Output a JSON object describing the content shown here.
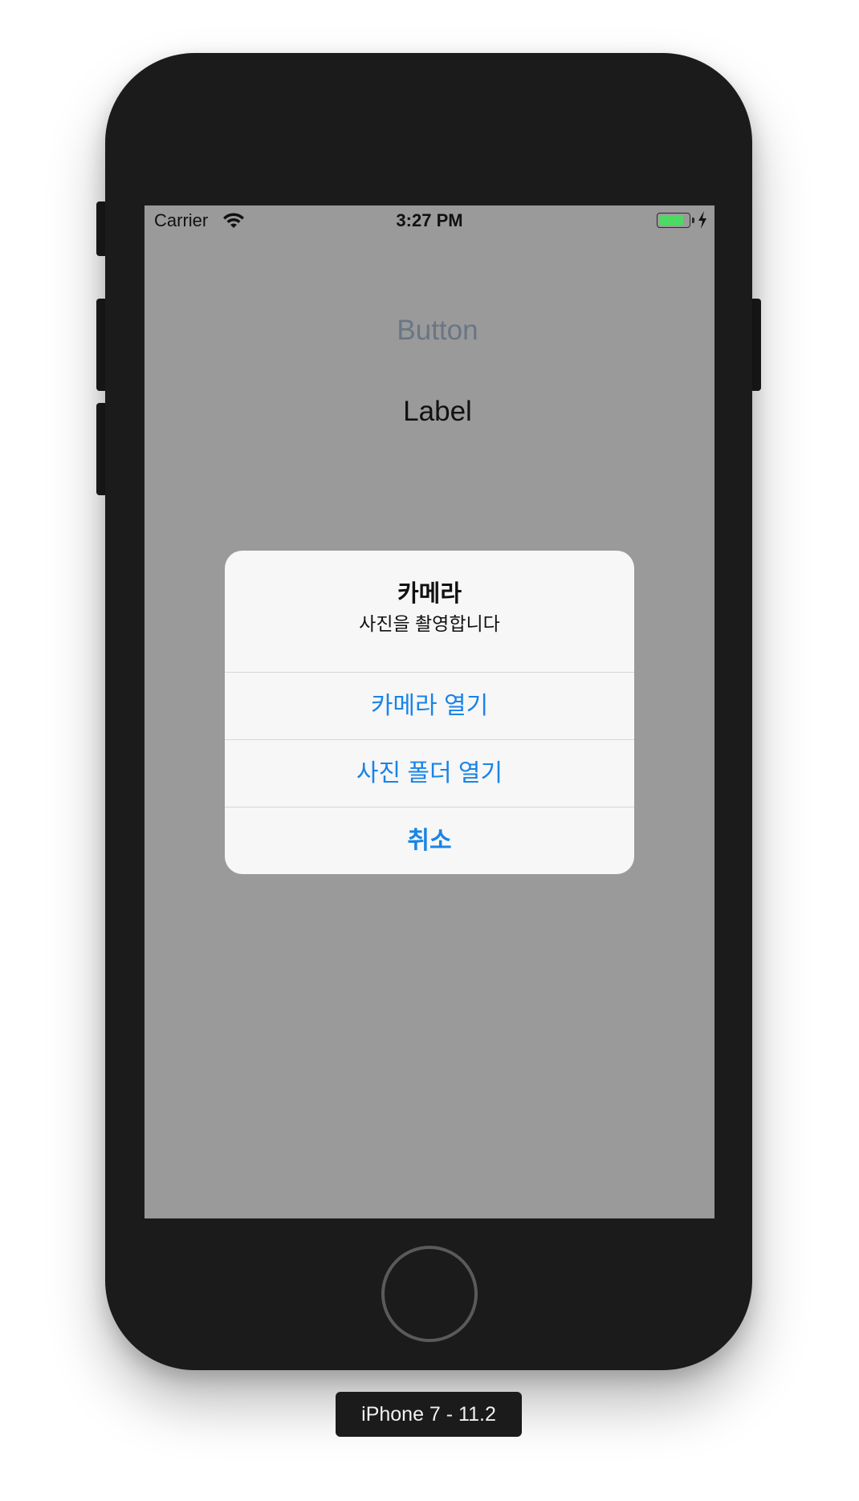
{
  "status_bar": {
    "carrier": "Carrier",
    "time": "3:27 PM",
    "wifi_icon": "wifi-icon",
    "battery_icon": "battery-icon",
    "charging_icon": "bolt-icon",
    "battery_color": "#4cd964"
  },
  "app": {
    "button_label": "Button",
    "label_text": "Label"
  },
  "alert": {
    "title": "카메라",
    "message": "사진을 촬영합니다",
    "actions": [
      {
        "label": "카메라 열기"
      },
      {
        "label": "사진 폴더 열기"
      },
      {
        "label": "취소"
      }
    ],
    "action_color": "#1a84e6"
  },
  "device": {
    "name": "iPhone 7 - 11.2"
  }
}
